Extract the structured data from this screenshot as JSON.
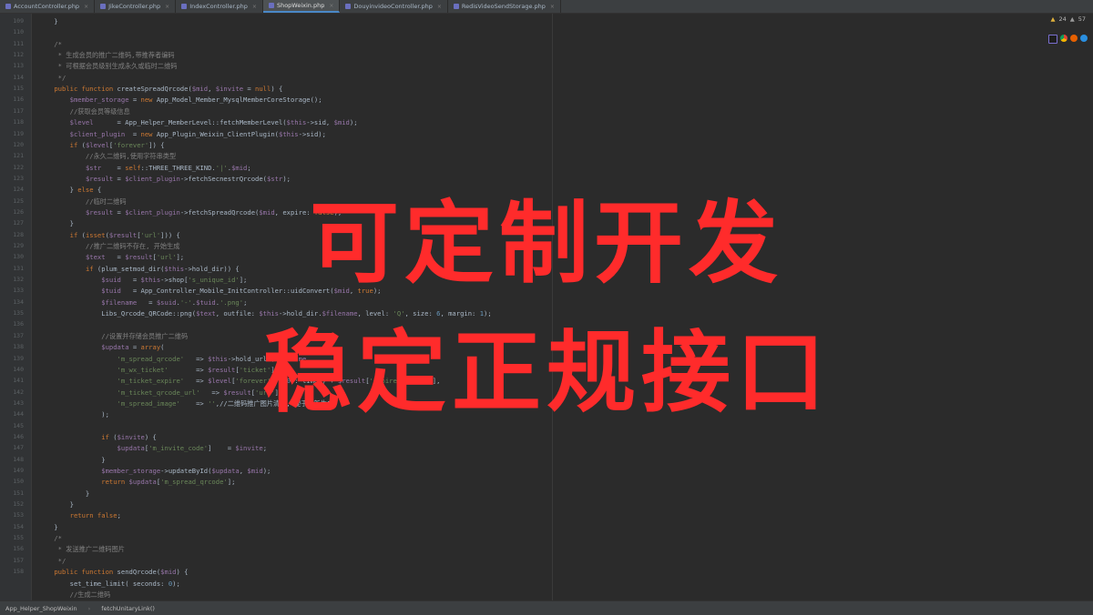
{
  "tabs": [
    {
      "label": "AccountController.php",
      "active": false
    },
    {
      "label": "JikeController.php",
      "active": false
    },
    {
      "label": "IndexController.php",
      "active": false
    },
    {
      "label": "ShopWeixin.php",
      "active": true
    },
    {
      "label": "DouyinvideoController.php",
      "active": false
    },
    {
      "label": "RedisVideoSendStorage.php",
      "active": false
    }
  ],
  "inspection": {
    "warnings": "24",
    "weak": "57"
  },
  "line_numbers": [
    "109",
    "110",
    "111",
    "112",
    "113",
    "114",
    "115",
    "116",
    "117",
    "118",
    "119",
    "120",
    "121",
    "122",
    "123",
    "124",
    "125",
    "126",
    "127",
    "128",
    "129",
    "130",
    "131",
    "132",
    "133",
    "134",
    "135",
    "136",
    "137",
    "138",
    "139",
    "140",
    "141",
    "142",
    "143",
    "144",
    "145",
    "146",
    "147",
    "148",
    "149",
    "150",
    "151",
    "152",
    "153",
    "154",
    "155",
    "156",
    "157",
    "158"
  ],
  "code_lines": [
    "    }",
    "",
    "    /*",
    "     * 生成会员的推广二维码,带推荐者编码",
    "     * 可根据会员级别生成永久或临时二维码",
    "     */",
    "    public function createSpreadQrcode($mid, $invite = null) {",
    "        $member_storage = new App_Model_Member_MysqlMemberCoreStorage();",
    "        //获取会员等级信息",
    "        $level      = App_Helper_MemberLevel::fetchMemberLevel($this->sid, $mid);",
    "        $client_plugin  = new App_Plugin_Weixin_ClientPlugin($this->sid);",
    "        if ($level['forever']) {",
    "            //永久二维码,使用字符串类型",
    "            $str    = self::THREE_THREE_KIND.'|'.$mid;",
    "            $result = $client_plugin->fetchSecnestrQrcode($str);",
    "        } else {",
    "            //临时二维码",
    "            $result = $client_plugin->fetchSpreadQrcode($mid, expire: false);",
    "        }",
    "        if (isset($result['url'])) {",
    "            //推广二维码不存在, 开始生成",
    "            $text   = $result['url'];",
    "            if (plum_setmod_dir($this->hold_dir)) {",
    "                $suid   = $this->shop['s_unique_id'];",
    "                $tuid   = App_Controller_Mobile_InitController::uidConvert($mid, true);",
    "                $filename   = $suid.'-'.$tuid.'.png';",
    "                Libs_Qrcode_QRCode::png($text, outfile: $this->hold_dir.$filename, level: 'Q', size: 6, margin: 1);",
    "",
    "                //设置并存储会员推广二维码",
    "                $updata = array(",
    "                    'm_spread_qrcode'   => $this->hold_url.$filename,",
    "                    'm_wx_ticket'       => $result['ticket'],",
    "                    'm_ticket_expire'   => $level['forever'] ? 0 : time() + $result['expire_seconds'],",
    "                    'm_ticket_qrcode_url'   => $result['url'],",
    "                    'm_spread_image'    => '',//二维码推广图片清空, 便于重新生成",
    "                );",
    "",
    "                if ($invite) {",
    "                    $updata['m_invite_code']    = $invite;",
    "                }",
    "                $member_storage->updateById($updata, $mid);",
    "                return $updata['m_spread_qrcode'];",
    "            }",
    "        }",
    "        return false;",
    "    }",
    "    /*",
    "     * 发送推广二维码图片",
    "     */",
    "    public function sendQrcode($mid) {",
    "        set_time_limit( seconds: 0);",
    "        //生成二维码"
  ],
  "overlay": {
    "line1": "可定制开发",
    "line2": "稳定正规接口"
  },
  "status": {
    "breadcrumb1": "App_Helper_ShopWeixin",
    "breadcrumb2": "fetchUnitaryLink()"
  }
}
